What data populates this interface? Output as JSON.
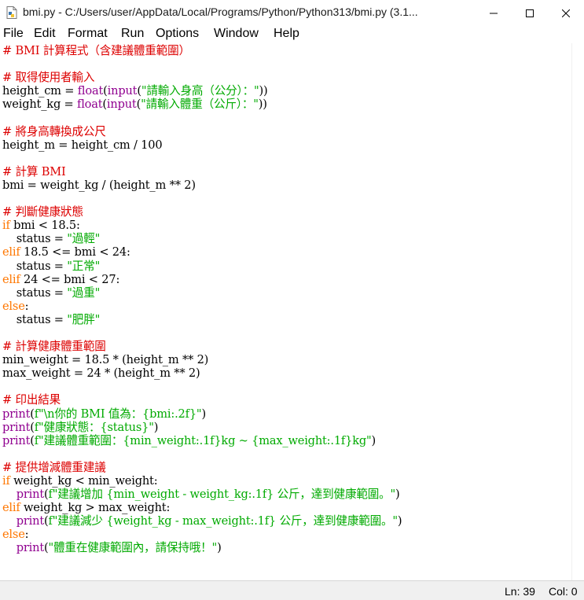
{
  "window": {
    "title": "bmi.py - C:/Users/user/AppData/Local/Programs/Python/Python313/bmi.py (3.1..."
  },
  "menu": [
    "File",
    "Edit",
    "Format",
    "Run",
    "Options",
    "Window",
    "Help"
  ],
  "code_lines": [
    [
      [
        "c",
        "# BMI 計算程式（含建議體重範圍）"
      ]
    ],
    [],
    [
      [
        "c",
        "# 取得使用者輸入"
      ]
    ],
    [
      [
        "n",
        "height_cm = "
      ],
      [
        "b",
        "float"
      ],
      [
        "n",
        "("
      ],
      [
        "b",
        "input"
      ],
      [
        "n",
        "("
      ],
      [
        "s",
        "\"請輸入身高（公分）：\""
      ],
      [
        "n",
        "))"
      ]
    ],
    [
      [
        "n",
        "weight_kg = "
      ],
      [
        "b",
        "float"
      ],
      [
        "n",
        "("
      ],
      [
        "b",
        "input"
      ],
      [
        "n",
        "("
      ],
      [
        "s",
        "\"請輸入體重（公斤）：\""
      ],
      [
        "n",
        "))"
      ]
    ],
    [],
    [
      [
        "c",
        "# 將身高轉換成公尺"
      ]
    ],
    [
      [
        "n",
        "height_m = height_cm / 100"
      ]
    ],
    [],
    [
      [
        "c",
        "# 計算 BMI"
      ]
    ],
    [
      [
        "n",
        "bmi = weight_kg / (height_m ** 2)"
      ]
    ],
    [],
    [
      [
        "c",
        "# 判斷健康狀態"
      ]
    ],
    [
      [
        "k",
        "if"
      ],
      [
        "n",
        " bmi < 18.5:"
      ]
    ],
    [
      [
        "n",
        "    status = "
      ],
      [
        "s",
        "\"過輕\""
      ]
    ],
    [
      [
        "k",
        "elif"
      ],
      [
        "n",
        " 18.5 <= bmi < 24:"
      ]
    ],
    [
      [
        "n",
        "    status = "
      ],
      [
        "s",
        "\"正常\""
      ]
    ],
    [
      [
        "k",
        "elif"
      ],
      [
        "n",
        " 24 <= bmi < 27:"
      ]
    ],
    [
      [
        "n",
        "    status = "
      ],
      [
        "s",
        "\"過重\""
      ]
    ],
    [
      [
        "k",
        "else"
      ],
      [
        "n",
        ":"
      ]
    ],
    [
      [
        "n",
        "    status = "
      ],
      [
        "s",
        "\"肥胖\""
      ]
    ],
    [],
    [
      [
        "c",
        "# 計算健康體重範圍"
      ]
    ],
    [
      [
        "n",
        "min_weight = 18.5 * (height_m ** 2)"
      ]
    ],
    [
      [
        "n",
        "max_weight = 24 * (height_m ** 2)"
      ]
    ],
    [],
    [
      [
        "c",
        "# 印出結果"
      ]
    ],
    [
      [
        "b",
        "print"
      ],
      [
        "n",
        "("
      ],
      [
        "s",
        "f\"\\n你的 BMI 值為：{bmi:.2f}\""
      ],
      [
        "n",
        ")"
      ]
    ],
    [
      [
        "b",
        "print"
      ],
      [
        "n",
        "("
      ],
      [
        "s",
        "f\"健康狀態：{status}\""
      ],
      [
        "n",
        ")"
      ]
    ],
    [
      [
        "b",
        "print"
      ],
      [
        "n",
        "("
      ],
      [
        "s",
        "f\"建議體重範圍：{min_weight:.1f}kg ~ {max_weight:.1f}kg\""
      ],
      [
        "n",
        ")"
      ]
    ],
    [],
    [
      [
        "c",
        "# 提供增減體重建議"
      ]
    ],
    [
      [
        "k",
        "if"
      ],
      [
        "n",
        " weight_kg < min_weight:"
      ]
    ],
    [
      [
        "n",
        "    "
      ],
      [
        "b",
        "print"
      ],
      [
        "n",
        "("
      ],
      [
        "s",
        "f\"建議增加 {min_weight - weight_kg:.1f} 公斤，達到健康範圍。\""
      ],
      [
        "n",
        ")"
      ]
    ],
    [
      [
        "k",
        "elif"
      ],
      [
        "n",
        " weight_kg > max_weight:"
      ]
    ],
    [
      [
        "n",
        "    "
      ],
      [
        "b",
        "print"
      ],
      [
        "n",
        "("
      ],
      [
        "s",
        "f\"建議減少 {weight_kg - max_weight:.1f} 公斤，達到健康範圍。\""
      ],
      [
        "n",
        ")"
      ]
    ],
    [
      [
        "k",
        "else"
      ],
      [
        "n",
        ":"
      ]
    ],
    [
      [
        "n",
        "    "
      ],
      [
        "b",
        "print"
      ],
      [
        "n",
        "("
      ],
      [
        "s",
        "\"體重在健康範圍內，請保持哦！\""
      ],
      [
        "n",
        ")"
      ]
    ]
  ],
  "status": {
    "line": "Ln: 39",
    "col": "Col: 0"
  },
  "icons": {
    "app": "python-file-icon",
    "minimize": "minimize-icon",
    "maximize": "maximize-icon",
    "close": "close-icon"
  },
  "colors": {
    "comment": "#dd0000",
    "string": "#00aa00",
    "keyword": "#ff7700",
    "builtin": "#900090"
  }
}
